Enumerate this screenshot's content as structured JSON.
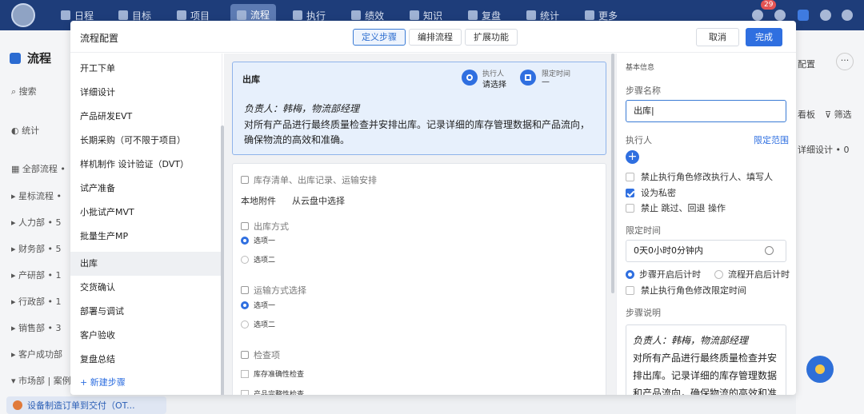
{
  "nav": {
    "items": [
      "日程",
      "目标",
      "项目",
      "流程",
      "执行",
      "绩效",
      "知识",
      "复盘",
      "统计",
      "更多"
    ],
    "notifications": "29"
  },
  "background": {
    "page_title": "流程",
    "search_placeholder": "搜索",
    "left_items": [
      "统计",
      "全部流程 •",
      "星标流程 •",
      "人力部 • 5",
      "财务部 • 5",
      "产研部 • 1",
      "行政部 • 1",
      "销售部 • 3",
      "客户成功部",
      "市场部 | 案例"
    ],
    "bottom_task": "设备制造订单到交付（OT...",
    "right_items": [
      "配置",
      "看板",
      "筛选",
      "详细设计 • 0"
    ]
  },
  "modal": {
    "title": "流程配置",
    "tabs": [
      "定义步骤",
      "编排流程",
      "扩展功能"
    ],
    "cancel": "取消",
    "done": "完成"
  },
  "steps": {
    "items": [
      "开工下单",
      "详细设计",
      "产品研发EVT",
      "长期采购（可不限于项目）",
      "样机制作 设计验证（DVT）",
      "试产准备",
      "小批试产MVT",
      "批量生产MP",
      "出库",
      "交货确认",
      "部署与调试",
      "客户验收",
      "复盘总结"
    ],
    "new_step": "+ 新建步骤"
  },
  "step_card": {
    "name": "出库",
    "executor_label": "执行人",
    "executor_value": "请选择",
    "time_label": "限定时间",
    "time_value": "—",
    "responsible": "负责人：韩梅，物流部经理",
    "description": "对所有产品进行最终质量检查并安排出库。记录详细的库存管理数据和产品流向，确保物流的高效和准确。"
  },
  "form": {
    "attachment_title": "库存清单、出库记录、运输安排",
    "local_attach": "本地附件",
    "cloud_select": "从云盘中选择",
    "q1_title": "出库方式",
    "q1_opt1": "选项一",
    "q1_opt2": "选项二",
    "q2_title": "运输方式选择",
    "q2_opt1": "选项一",
    "q2_opt2": "选项二",
    "q3_title": "检查项",
    "q3_item1": "库存准确性检查",
    "q3_item2": "产品完整性检查"
  },
  "right": {
    "section": "基本信息",
    "step_name_label": "步骤名称",
    "step_name_value": "出库|",
    "executor_label": "执行人",
    "scope_link": "限定范围",
    "chk1": "禁止执行角色修改执行人、填写人",
    "chk2": "设为私密",
    "chk3": "禁止 跳过、回退 操作",
    "time_label": "限定时间",
    "time_value": "0天0小时0分钟内",
    "radio1": "步骤开启后计时",
    "radio2": "流程开启后计时",
    "chk4": "禁止执行角色修改限定时间",
    "desc_label": "步骤说明",
    "desc_italic": "负责人：韩梅，物流部经理",
    "desc_text": "对所有产品进行最终质量检查并安排出库。记录详细的库存管理数据和产品流向，确保物流的高效和准确。"
  }
}
